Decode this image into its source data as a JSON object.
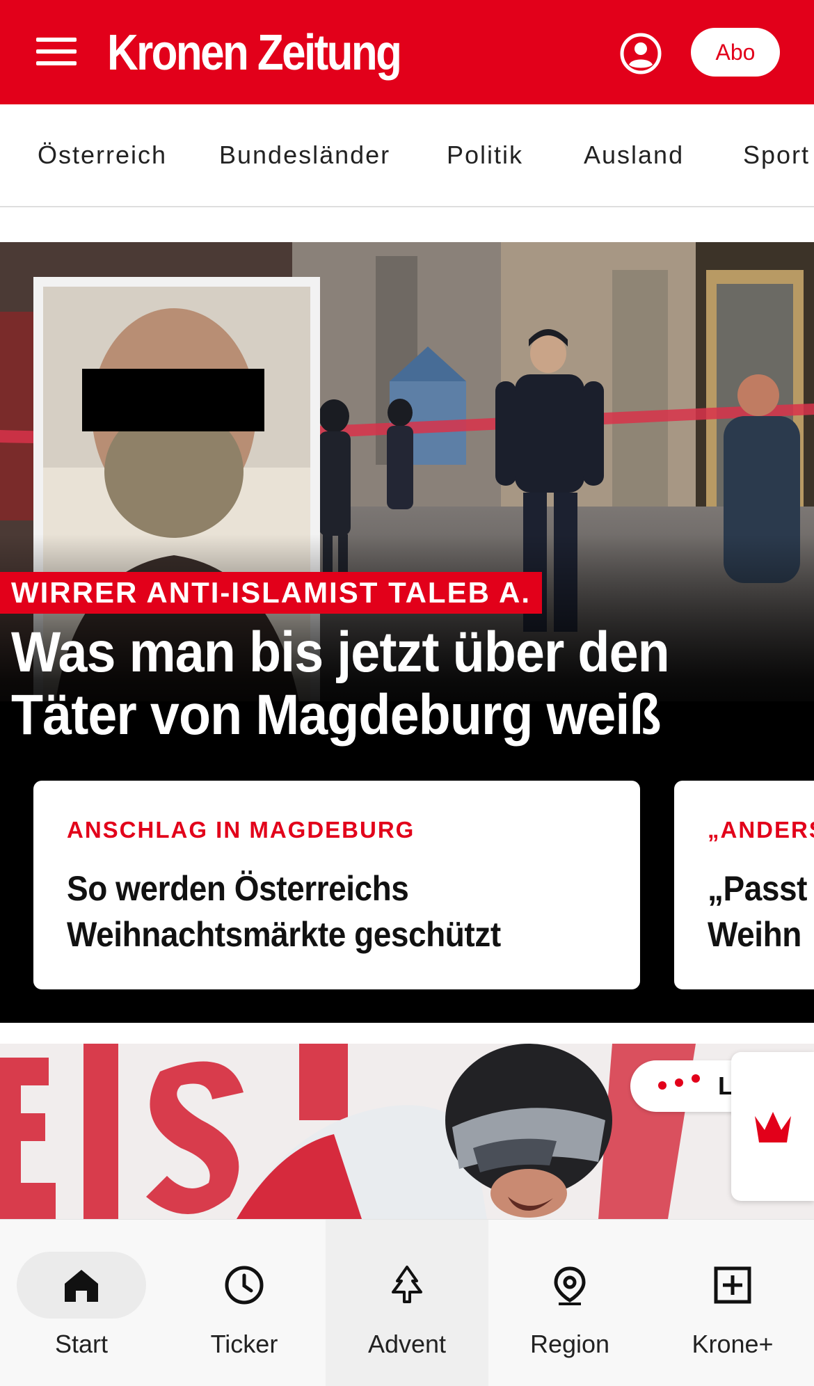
{
  "header": {
    "logo": "Kronen Zeitung",
    "abo_label": "Abo",
    "menu_icon": "hamburger-menu-icon",
    "account_icon": "user-account-icon",
    "brand_color": "#e2001a"
  },
  "categories": [
    {
      "label": "Österreich"
    },
    {
      "label": "Bundesländer"
    },
    {
      "label": "Politik"
    },
    {
      "label": "Ausland"
    },
    {
      "label": "Sport"
    }
  ],
  "hero": {
    "kicker": "WIRRER ANTI-ISLAMIST TALEB A.",
    "headline_line1": "Was man bis jetzt über den",
    "headline_line2": "Täter von Magdeburg weiß"
  },
  "cards": [
    {
      "kicker": "ANSCHLAG IN MAGDEBURG",
      "title_line1": "So werden Österreichs",
      "title_line2": "Weihnachtsmärkte geschützt"
    },
    {
      "kicker": "„ANDERS",
      "title_line1": "„Passt",
      "title_line2": "Weihn"
    }
  ],
  "article2": {
    "live_label": "LIVE",
    "widget_icon": "krone-crown-icon"
  },
  "bottom_nav": [
    {
      "label": "Start",
      "icon": "home-icon",
      "active": true
    },
    {
      "label": "Ticker",
      "icon": "clock-icon",
      "active": false
    },
    {
      "label": "Advent",
      "icon": "christmas-tree-icon",
      "active": false
    },
    {
      "label": "Region",
      "icon": "location-pin-icon",
      "active": false
    },
    {
      "label": "Krone+",
      "icon": "plus-square-icon",
      "active": false
    }
  ]
}
